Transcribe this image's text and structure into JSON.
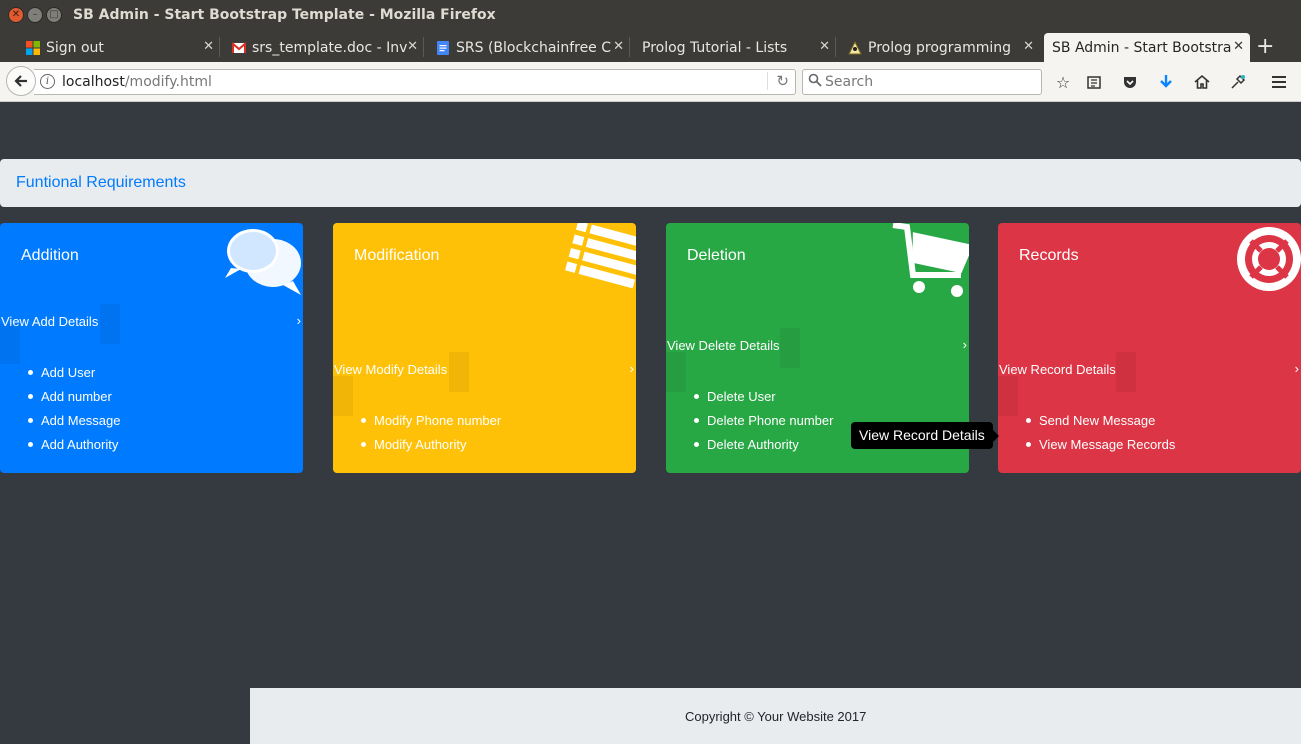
{
  "window": {
    "title": "SB Admin - Start Bootstrap Template - Mozilla Firefox"
  },
  "tabs": [
    {
      "label": "Sign out",
      "icon": "microsoft-icon"
    },
    {
      "label": "srs_template.doc - Inv",
      "icon": "gmail-icon"
    },
    {
      "label": "SRS (Blockchainfree C",
      "icon": "google-docs-icon"
    },
    {
      "label": "Prolog Tutorial - Lists",
      "icon": "none"
    },
    {
      "label": "Prolog programming",
      "icon": "prolog-icon"
    },
    {
      "label": "SB Admin - Start Bootstra",
      "icon": "none",
      "active": true
    }
  ],
  "navbar": {
    "url_host": "localhost",
    "url_path": "/modify.html",
    "search_placeholder": "Search"
  },
  "page": {
    "breadcrumb": "Funtional Requirements",
    "cards": [
      {
        "title": "Addition",
        "link": "View Add Details",
        "color": "#007bff",
        "icon": "comments-icon",
        "items": [
          "Add User",
          "Add number",
          "Add Message",
          "Add Authority"
        ]
      },
      {
        "title": "Modification",
        "link": "View Modify Details",
        "color": "#ffc107",
        "icon": "list-icon",
        "items": [
          "Modify Phone number",
          "Modify Authority"
        ]
      },
      {
        "title": "Deletion",
        "link": "View Delete Details",
        "color": "#28a745",
        "icon": "shopping-cart-icon",
        "items": [
          "Delete User",
          "Delete Phone number",
          "Delete Authority"
        ]
      },
      {
        "title": "Records",
        "link": "View Record Details",
        "color": "#dc3545",
        "icon": "life-ring-icon",
        "items": [
          "Send New Message",
          "View Message Records"
        ]
      }
    ],
    "tooltip": "View Record Details",
    "footer": "Copyright © Your Website 2017"
  }
}
